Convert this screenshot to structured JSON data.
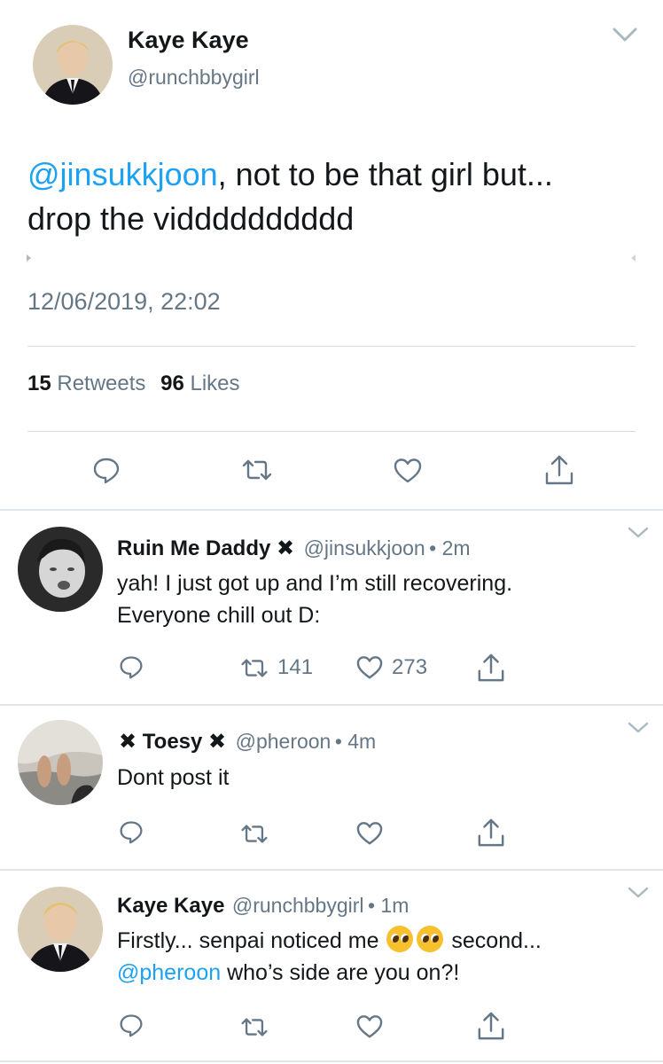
{
  "main_tweet": {
    "name": "Kaye Kaye",
    "handle": "@runchbbygirl",
    "mention": "@jinsukkjoon",
    "text_after_mention": ", not to be that girl but...",
    "text_line2": "drop the vidddddddddd",
    "timestamp": "12/06/2019, 22:02",
    "retweets_count": "15",
    "retweets_label": "Retweets",
    "likes_count": "96",
    "likes_label": "Likes"
  },
  "replies": [
    {
      "name": "Ruin Me Daddy ✖",
      "handle": "@jinsukkjoon",
      "time": "• 2m",
      "line1": "yah! I just got up and I’m still recovering.",
      "line2": "Everyone chill out D:",
      "retweets": "141",
      "likes": "273"
    },
    {
      "name": "✖ Toesy ✖",
      "handle": "@pheroon",
      "time": "• 4m",
      "line1": "Dont post it"
    },
    {
      "name": "Kaye Kaye",
      "handle": "@runchbbygirl",
      "time": "• 1m",
      "line1_a": "Firstly... senpai noticed me",
      "line1_b": "second...",
      "mention": "@pheroon",
      "line2": "who’s side are you on?!"
    }
  ],
  "icons": {
    "reply": "reply-icon",
    "retweet": "retweet-icon",
    "like": "heart-icon",
    "share": "share-icon",
    "chevron": "chevron-down-icon",
    "emoji": "pleading-face-emoji"
  },
  "colors": {
    "link": "#1da1f2",
    "secondary_text": "#657786",
    "primary_text": "#14171a",
    "divider": "#e1e8ed"
  }
}
